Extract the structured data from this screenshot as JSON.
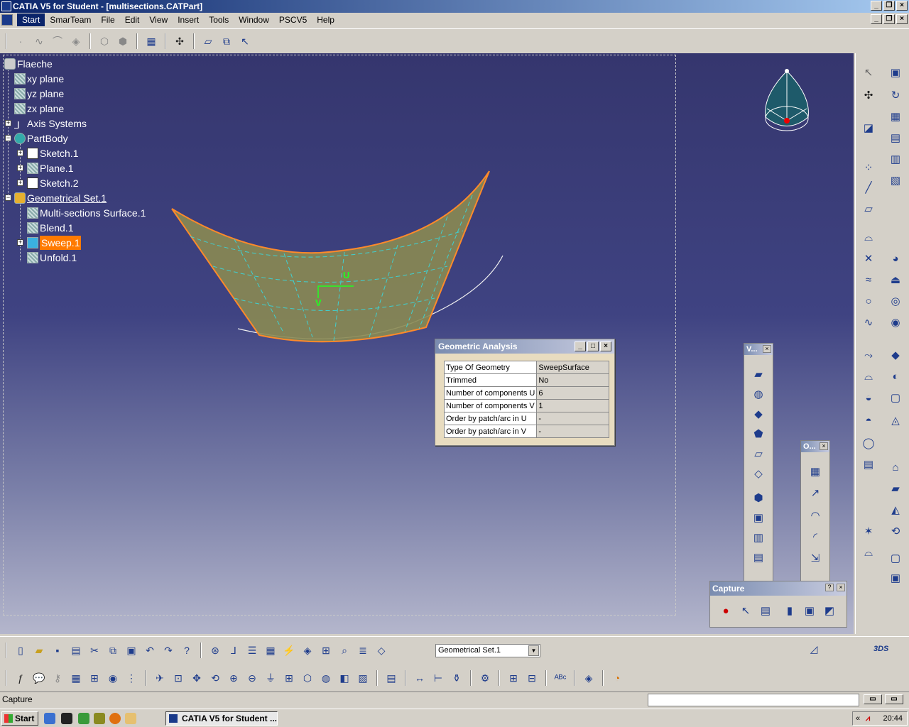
{
  "window": {
    "title": "CATIA V5 for Student - [multisections.CATPart]"
  },
  "menu": [
    "Start",
    "SmarTeam",
    "File",
    "Edit",
    "View",
    "Insert",
    "Tools",
    "Window",
    "PSCV5",
    "Help"
  ],
  "tree": {
    "root": "Flaeche",
    "planes": [
      "xy plane",
      "yz plane",
      "zx plane"
    ],
    "axis_systems": "Axis Systems",
    "partbody": "PartBody",
    "partbody_children": [
      "Sketch.1",
      "Plane.1",
      "Sketch.2"
    ],
    "geometrical_set": "Geometrical Set.1",
    "gs_children": [
      "Multi-sections Surface.1",
      "Blend.1",
      "Sweep.1",
      "Unfold.1"
    ]
  },
  "viewport": {
    "u_label": "U",
    "v_label": "V"
  },
  "geometric_analysis": {
    "title": "Geometric Analysis",
    "rows": [
      {
        "key": "Type Of Geometry",
        "value": "SweepSurface"
      },
      {
        "key": "Trimmed",
        "value": "No"
      },
      {
        "key": "Number of components U",
        "value": "6"
      },
      {
        "key": "Number of components V",
        "value": "1"
      },
      {
        "key": "Order by patch/arc in U",
        "value": "-"
      },
      {
        "key": "Order by patch/arc in V",
        "value": "-"
      }
    ]
  },
  "panels": {
    "v_title": "V...",
    "o_title": "O...",
    "capture_title": "Capture",
    "help_glyph": "?"
  },
  "bottom_toolbar": {
    "current_set": "Geometrical Set.1"
  },
  "status": {
    "text": "Capture"
  },
  "taskbar": {
    "start": "Start",
    "task": "CATIA V5 for Student ...",
    "clock": "20:44",
    "tray_arrows": "«"
  },
  "colors": {
    "surface": "#8a8a52",
    "edge": "#ff8a2a",
    "iso": "#3fd0d0",
    "selection": "#ff7a00"
  }
}
